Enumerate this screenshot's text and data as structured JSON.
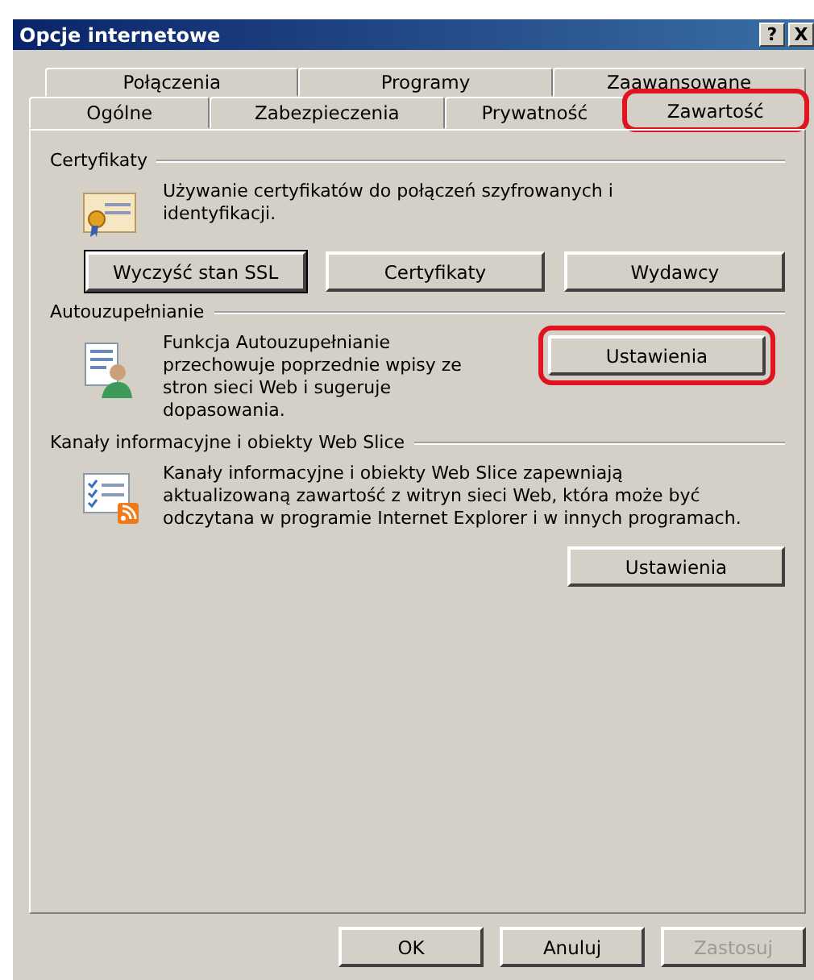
{
  "window": {
    "title": "Opcje internetowe",
    "help_button": "?",
    "close_button": "X"
  },
  "tab_rows": [
    [
      {
        "label": "Połączenia",
        "selected": false,
        "highlighted": false
      },
      {
        "label": "Programy",
        "selected": false,
        "highlighted": false
      },
      {
        "label": "Zaawansowane",
        "selected": false,
        "highlighted": false
      }
    ],
    [
      {
        "label": "Ogólne",
        "selected": false,
        "highlighted": false
      },
      {
        "label": "Zabezpieczenia",
        "selected": false,
        "highlighted": false
      },
      {
        "label": "Prywatność",
        "selected": false,
        "highlighted": false
      },
      {
        "label": "Zawartość",
        "selected": true,
        "highlighted": true
      }
    ]
  ],
  "sections": [
    {
      "title": "Certyfikaty",
      "kind": "certificates",
      "description": "Używanie certyfikatów do połączeń szyfrowanych i identyfikacji.",
      "buttons": [
        {
          "label": "Wyczyść stan SSL",
          "highlighted": false,
          "focused": true
        },
        {
          "label": "Certyfikaty",
          "highlighted": false,
          "focused": false
        },
        {
          "label": "Wydawcy",
          "highlighted": false,
          "focused": false
        }
      ]
    },
    {
      "title": "Autouzupełnianie",
      "kind": "side",
      "description": "Funkcja Autouzupełnianie przechowuje poprzednie wpisy ze stron sieci Web i sugeruje dopasowania.",
      "buttons": [
        {
          "label": "Ustawienia",
          "highlighted": true,
          "focused": false
        }
      ]
    },
    {
      "title": "Kanały informacyjne i obiekty Web Slice",
      "kind": "below",
      "description": "Kanały informacyjne i obiekty Web Slice zapewniają aktualizowaną zawartość z witryn sieci Web, która może być odczytana w programie Internet Explorer i w innych programach.",
      "buttons": [
        {
          "label": "Ustawienia",
          "highlighted": false,
          "focused": false
        }
      ]
    }
  ],
  "footer_buttons": [
    {
      "label": "OK",
      "disabled": false
    },
    {
      "label": "Anuluj",
      "disabled": false
    },
    {
      "label": "Zastosuj",
      "disabled": true
    }
  ]
}
